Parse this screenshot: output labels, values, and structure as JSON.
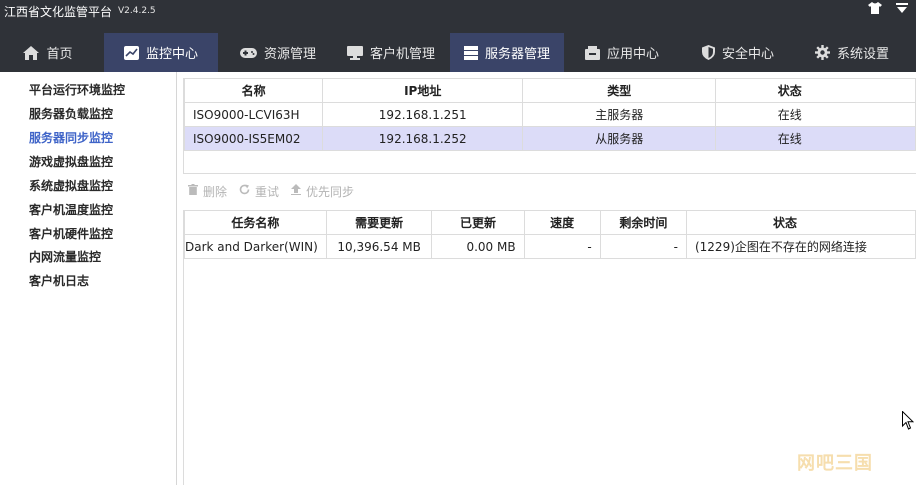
{
  "app": {
    "title": "江西省文化监管平台",
    "version": "V2.4.2.5"
  },
  "nav": [
    {
      "label": "首页",
      "icon": "home-icon"
    },
    {
      "label": "监控中心",
      "icon": "chart-icon",
      "active": true
    },
    {
      "label": "资源管理",
      "icon": "gamepad-icon"
    },
    {
      "label": "客户机管理",
      "icon": "monitor-icon"
    },
    {
      "label": "服务器管理",
      "icon": "server-icon",
      "active_section": true
    },
    {
      "label": "应用中心",
      "icon": "app-box-icon"
    },
    {
      "label": "安全中心",
      "icon": "shield-icon"
    },
    {
      "label": "系统设置",
      "icon": "gear-icon"
    }
  ],
  "sidebar": [
    {
      "label": "平台运行环境监控"
    },
    {
      "label": "服务器负载监控"
    },
    {
      "label": "服务器同步监控",
      "active": true
    },
    {
      "label": "游戏虚拟盘监控"
    },
    {
      "label": "系统虚拟盘监控"
    },
    {
      "label": "客户机温度监控"
    },
    {
      "label": "客户机硬件监控"
    },
    {
      "label": "内网流量监控"
    },
    {
      "label": "客户机日志"
    }
  ],
  "servers": {
    "headers": [
      "名称",
      "IP地址",
      "类型",
      "状态"
    ],
    "rows": [
      {
        "name": "ISO9000-LCVI63H",
        "ip": "192.168.1.251",
        "type": "主服务器",
        "status": "在线"
      },
      {
        "name": "ISO9000-IS5EM02",
        "ip": "192.168.1.252",
        "type": "从服务器",
        "status": "在线",
        "selected": true
      }
    ]
  },
  "toolbar": {
    "delete": "删除",
    "retry": "重试",
    "priority": "优先同步"
  },
  "tasks": {
    "headers": [
      "任务名称",
      "需要更新",
      "已更新",
      "速度",
      "剩余时间",
      "状态"
    ],
    "rows": [
      {
        "name": "Dark and Darker(WIN)",
        "need": "10,396.54 MB",
        "done": "0.00 MB",
        "speed": "-",
        "remaining": "-",
        "status": "(1229)企图在不存在的网络连接"
      }
    ]
  },
  "watermark": "网吧三国",
  "colors": {
    "nav_bg": "#2f3238",
    "nav_active": "#3a4468",
    "sidebar_active": "#3f64c8",
    "row_selected": "#dcdcf8"
  }
}
